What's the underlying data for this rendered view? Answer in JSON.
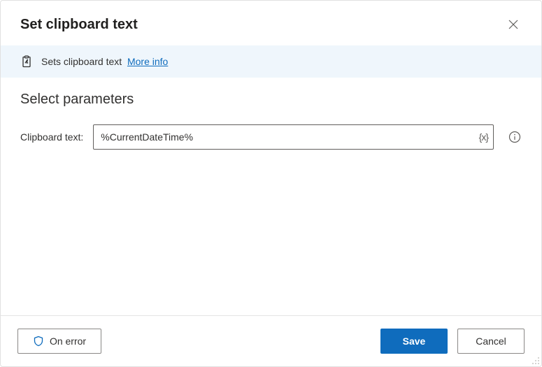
{
  "header": {
    "title": "Set clipboard text"
  },
  "banner": {
    "description": "Sets clipboard text",
    "more_info_label": "More info"
  },
  "section": {
    "heading": "Select parameters"
  },
  "params": {
    "clipboard_text": {
      "label": "Clipboard text:",
      "value": "%CurrentDateTime%",
      "variable_token_label": "{x}"
    }
  },
  "footer": {
    "on_error_label": "On error",
    "save_label": "Save",
    "cancel_label": "Cancel"
  }
}
